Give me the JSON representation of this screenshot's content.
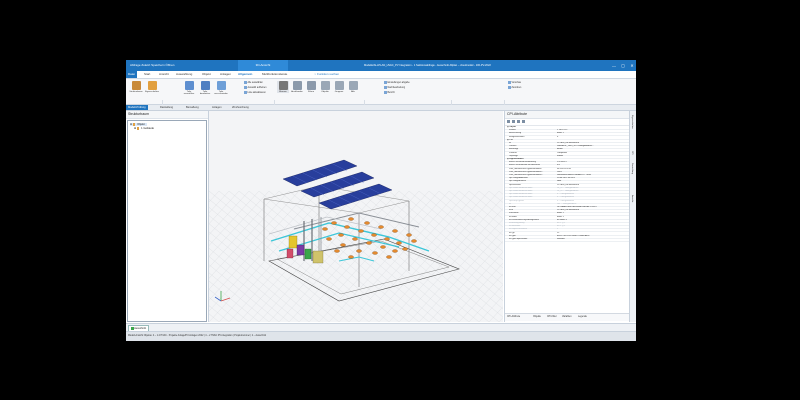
{
  "window": {
    "title_left": "Abfrage Zuletzt Speichern Öffnen",
    "context_tab": "3D-Ansicht",
    "title_center": "Modelle\\ALLPLAN_HVAC_PV Integration - 1 Sektionsabfrage - Ausschnitt Allplan – cloudmodel - 100-PV-2022",
    "controls": [
      "—",
      "▢",
      "✕"
    ]
  },
  "menu": {
    "file": "Datei",
    "tabs": [
      "Start",
      "Ansicht",
      "Auswahlung",
      "Objekt",
      "Anlagen",
      "Allgemein",
      "Werkzeuge"
    ],
    "active": "Allgemein",
    "extra": "Multifunktionsleiste",
    "search": "♀ Funktion suchen"
  },
  "ribbon": {
    "big_buttons": [
      "Strukturbaum",
      "Eigenschaften",
      "Teile auswählen",
      "Teile bearbeiten",
      "Teile ausschneiden"
    ],
    "small_col1": [
      "Alle auswählen",
      "Auswahl aufheben",
      "Liste aktualisieren"
    ],
    "small_col2": [
      "Ebenen",
      "Ausblenden",
      "Filtern"
    ],
    "small_col3": [
      "Objekte",
      "Gruppen",
      "Alle"
    ],
    "small_col4": [
      "Einstellungen abgabe",
      "Nachbearbeitung",
      "Bericht"
    ],
    "groups": [
      "Modell",
      "Ansicht",
      "Auswahl",
      "Anzeige",
      "Bearbeiten",
      "Freigabe",
      "Extras"
    ],
    "right_small": [
      "Vorschau",
      "Zuordnen"
    ]
  },
  "view_tabs": [
    "Modell-Prüfung",
    "Darstellung",
    "Bemaßung",
    "Anlagen",
    "2D-Zuordnung"
  ],
  "view_tab_active": "Modell-Prüfung",
  "left_pane": {
    "title": "Strukturbaum",
    "nodes": [
      "Objekt",
      "1 Gebäude"
    ]
  },
  "right_pane": {
    "title": "CPI-Attribute",
    "rows": [
      {
        "k": "Objekt",
        "v": "",
        "type": "section"
      },
      {
        "k": "Volltext",
        "v": "1 14.0.5.12",
        "type": ""
      },
      {
        "k": "Bezeichnung",
        "v": "BN02 2",
        "type": ""
      },
      {
        "k": "Mengenvolumen",
        "v": "0",
        "type": ""
      },
      {
        "k": "CPI",
        "v": "",
        "type": "section"
      },
      {
        "k": "Id",
        "v": "1V7B03_RBTeuro4kxl.e",
        "type": ""
      },
      {
        "k": "Content",
        "v": "Dateiteil.ic_1030_20.1-Übergabeduss...",
        "type": ""
      },
      {
        "k": "Bauteiltyp",
        "v": "Brutto",
        "type": ""
      },
      {
        "k": "Zustand",
        "v": "Composite",
        "type": ""
      },
      {
        "k": "Objekttyp",
        "v": "Kombi",
        "type": ""
      },
      {
        "k": "Eigenschaften",
        "v": "",
        "type": "section"
      },
      {
        "k": "BIMx.Pset.HeatFlowMetering",
        "v": "1.0/1452/7",
        "type": ""
      },
      {
        "k": "BIMx.Pset.ElementPlacementInfo",
        "v": "0.0",
        "type": ""
      },
      {
        "k": "Pset_ManufacturerTypeInformation",
        "v": "38.1152/1+614",
        "type": ""
      },
      {
        "k": "Pset_ManufacturerTypeInformation...",
        "v": "1863",
        "type": ""
      },
      {
        "k": "Pset_ManufacturerTypeInformation...",
        "v": "Reinverker-bauelt.       BEsAe.DO · 6085",
        "type": ""
      },
      {
        "k": "cpiChangedAttribute",
        "v": "20.06.2022 08:23:0",
        "type": ""
      },
      {
        "k": "cpiChangedStatus",
        "v": "New",
        "type": ""
      },
      {
        "k": "cpiGeneralID",
        "v": "1V7B03_RBTeuro4kxl.e",
        "type": ""
      },
      {
        "k": "cpiContainerIdentification",
        "v": "1e_ID – Übergabeduss",
        "type": "gray"
      },
      {
        "k": "cpiContainerIdentification",
        "v": "1e_ID – Übergabeduss",
        "type": "gray"
      },
      {
        "k": "cpiContainerIdentification",
        "v": "0 – Übergabeduss",
        "type": "gray"
      },
      {
        "k": "cpiContainerIdentification",
        "v": "0 – Übergabeduss",
        "type": "gray"
      },
      {
        "k": "cpiGroupTypeId",
        "v": "0 – Übergabeduss",
        "type": "gray"
      },
      {
        "k": "Id",
        "v": "1e1 – Übergabeduss",
        "type": "gray"
      },
      {
        "k": "ifcGuid",
        "v": "1E7eBAcb.uBu.eEla.bebm.uuEcbE 120527",
        "type": ""
      },
      {
        "k": "IfcId",
        "v": "1V7B03_RBTeuro4kxl.e",
        "type": ""
      },
      {
        "k": "Kurzname",
        "v": "BN02 2",
        "type": ""
      },
      {
        "k": "IfcName",
        "v": "BN02 2",
        "type": ""
      },
      {
        "k": "IfcPresentationLayerAssignment",
        "v": "B1.BN02.2",
        "type": ""
      },
      {
        "k": "IfcBuildingStorey",
        "v": "B1.2 Q 1",
        "type": "gray"
      },
      {
        "k": "IfcSiteName",
        "v": "B1.2 Q 1",
        "type": "gray"
      },
      {
        "k": "IfcObjectPlacement",
        "v": "2",
        "type": "gray"
      },
      {
        "k": "IfcTyp",
        "v": "12",
        "type": ""
      },
      {
        "k": "IfcType",
        "v": "ELECTRICDISTRIBUTIONBOARD",
        "type": ""
      },
      {
        "k": "IfcTypeObjectName",
        "v": "Verteiler",
        "type": ""
      }
    ],
    "tabs": [
      "CPI-Attribute",
      "Objekte",
      "CPI-Filter",
      "Variablen",
      "Legende"
    ]
  },
  "right_sidebar": [
    "Eigenschaften",
    "CPI",
    "Darstellung",
    "Ansicht"
  ],
  "bottom_tab": "Ausschnitt",
  "status_bar": "Modell-Ansicht     Objekte:   4 – 1.2 HVAC - Projekte Anlage/PV-Anlagen 2022   |   4 – 2 HVAC PV-Integration   |   Projektnummer   |   2 – Ausschnitt",
  "colors": {
    "accent": "#1f74bf",
    "panel_solar": "#283e9c",
    "pipe_cyan": "#3cc6d8",
    "equipment_orange": "#e48a2e",
    "equipment_purple": "#7a3aa6",
    "equipment_yellow": "#d8cf2e",
    "equipment_green": "#3aa64a"
  }
}
